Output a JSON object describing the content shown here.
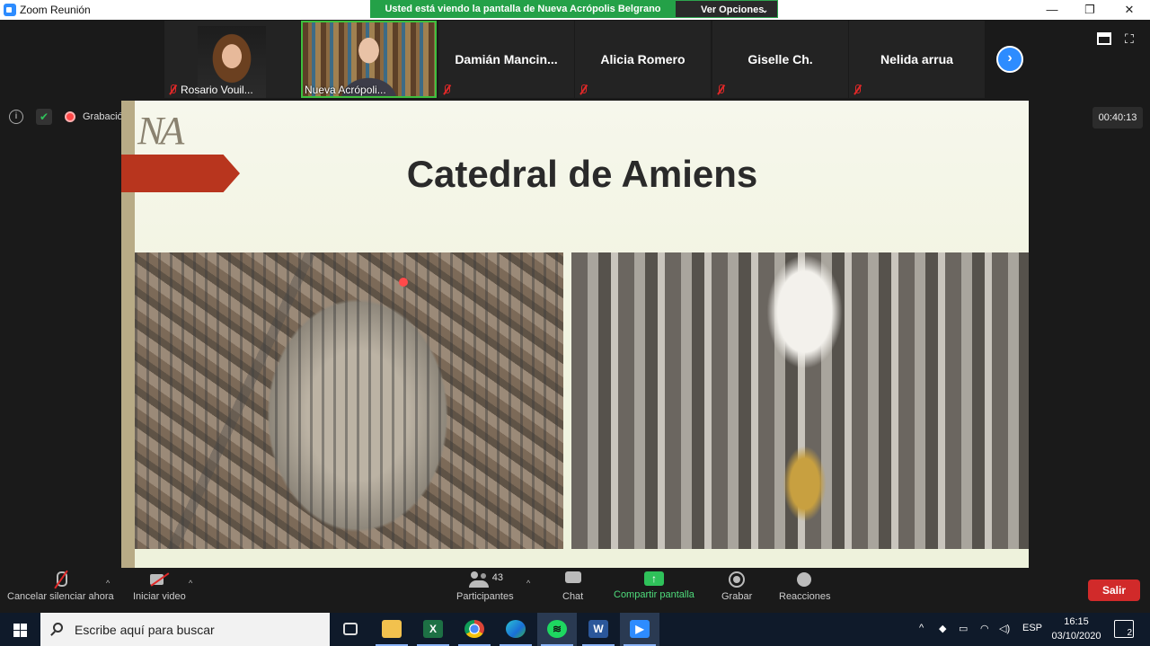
{
  "window": {
    "title": "Zoom Reunión",
    "controls": [
      "—",
      "❐",
      "✕"
    ]
  },
  "share_banner": {
    "text": "Usted está viendo la pantalla de Nueva Acrópolis Belgrano",
    "view_options": "Ver Opciones"
  },
  "participants": [
    {
      "name": "Rosario Vouil...",
      "has_video": true
    },
    {
      "name": "Nueva Acrópoli...",
      "has_video": true,
      "active_speaker": true
    },
    {
      "name": "Damián  Mancin...",
      "has_video": false
    },
    {
      "name": "Alicia Romero",
      "has_video": false
    },
    {
      "name": "Giselle Ch.",
      "has_video": false
    },
    {
      "name": "Nelida arrua",
      "has_video": false
    }
  ],
  "next_page_icon": "chevron-right-icon",
  "recording": {
    "label": "Grabación"
  },
  "timer": "00:40:13",
  "slide": {
    "logo": "NA",
    "title": "Catedral de Amiens"
  },
  "toolbar": {
    "mute_label": "Cancelar silenciar ahora",
    "video_label": "Iniciar video",
    "participants_label": "Participantes",
    "participants_count": "43",
    "chat_label": "Chat",
    "share_label": "Compartir pantalla",
    "record_label": "Grabar",
    "reactions_label": "Reacciones",
    "leave_label": "Salir"
  },
  "taskbar": {
    "search_placeholder": "Escribe aquí para buscar",
    "apps": [
      "task-view",
      "file-explorer",
      "excel",
      "chrome",
      "edge",
      "spotify",
      "word",
      "zoom"
    ],
    "language": "ESP",
    "time": "16:15",
    "date": "03/10/2020",
    "notifications": "2"
  },
  "colors": {
    "banner": "#24a148",
    "zoom_blue": "#2d8cff",
    "leave": "#d12a2a",
    "slide_arrow": "#b8351e"
  }
}
